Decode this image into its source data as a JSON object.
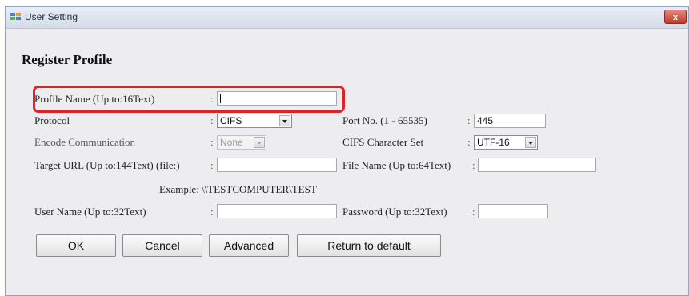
{
  "window": {
    "title": "User Setting",
    "close_label": "x"
  },
  "heading": "Register Profile",
  "fields": {
    "profile_name": {
      "label": "Profile Name (Up to:16Text)",
      "value": ""
    },
    "protocol": {
      "label": "Protocol",
      "value": "CIFS"
    },
    "port": {
      "label": "Port No. (1 - 65535)",
      "value": "445"
    },
    "encode": {
      "label": "Encode Communication",
      "value": "None"
    },
    "charset": {
      "label": "CIFS Character Set",
      "value": "UTF-16"
    },
    "target_url": {
      "label": "Target URL (Up to:144Text) (file:)",
      "value": ""
    },
    "file_name": {
      "label": "File Name (Up to:64Text)",
      "value": ""
    },
    "example": "Example: \\\\TESTCOMPUTER\\TEST",
    "user_name": {
      "label": "User Name (Up to:32Text)",
      "value": ""
    },
    "password": {
      "label": "Password (Up to:32Text)",
      "value": ""
    }
  },
  "colon": ":",
  "buttons": {
    "ok": "OK",
    "cancel": "Cancel",
    "advanced": "Advanced",
    "return_default": "Return to default"
  },
  "colors": {
    "highlight": "#d8242b",
    "close": "#c0392b"
  }
}
